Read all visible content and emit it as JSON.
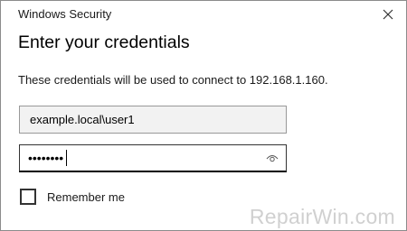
{
  "window": {
    "title": "Windows Security",
    "close_icon": "close-icon"
  },
  "dialog": {
    "heading": "Enter your credentials",
    "message": "These credentials will be used to connect to 192.168.1.160."
  },
  "username_field": {
    "value": "example.local\\user1"
  },
  "password_field": {
    "masked_value": "••••••••",
    "reveal_icon": "eye-icon"
  },
  "remember_me": {
    "label": "Remember me",
    "checked": false
  },
  "watermark": {
    "text": "RepairWin.com"
  },
  "colors": {
    "border": "#8c8c8c",
    "field_disabled_bg": "#f2f2f2",
    "focus_underline": "#000000",
    "watermark": "#d0d0d0"
  }
}
